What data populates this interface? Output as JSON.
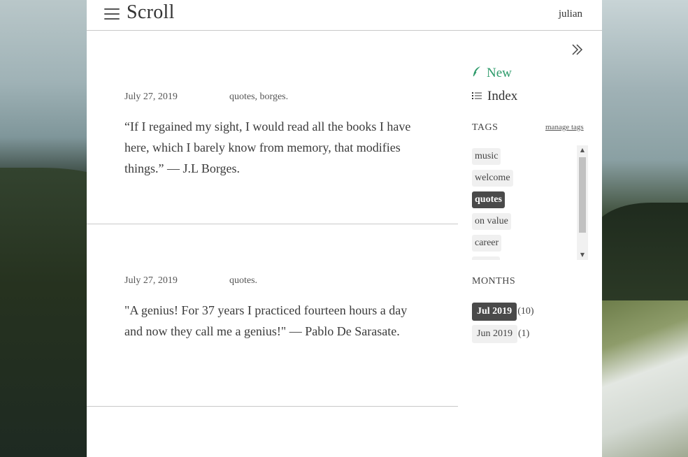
{
  "header": {
    "title": "Scroll",
    "user": "julian"
  },
  "posts": [
    {
      "date": "July 27, 2019",
      "tags": "quotes, borges.",
      "text": "“If I regained my sight, I would read all the books I have here, which I barely know from memory, that modifies things.” — J.L Borges."
    },
    {
      "date": "July 27, 2019",
      "tags": "quotes.",
      "text": "\"A genius! For 37 years I practiced fourteen hours a day and now they call me a genius!\" — Pablo De Sarasate."
    }
  ],
  "sidebar": {
    "new_label": "New",
    "index_label": "Index",
    "tags_heading": "TAGS",
    "manage_tags": "manage tags",
    "tags": [
      {
        "label": "music",
        "active": false
      },
      {
        "label": "welcome",
        "active": false
      },
      {
        "label": "quotes",
        "active": true
      },
      {
        "label": "on value",
        "active": false
      },
      {
        "label": "career",
        "active": false
      }
    ],
    "months_heading": "MONTHS",
    "months": [
      {
        "label": "Jul 2019",
        "count": "(10)",
        "active": true
      },
      {
        "label": "Jun 2019",
        "count": "(1)",
        "active": false
      }
    ]
  },
  "colors": {
    "accent_green": "#2e9b6b",
    "active_tag_bg": "#4a4a4a"
  }
}
